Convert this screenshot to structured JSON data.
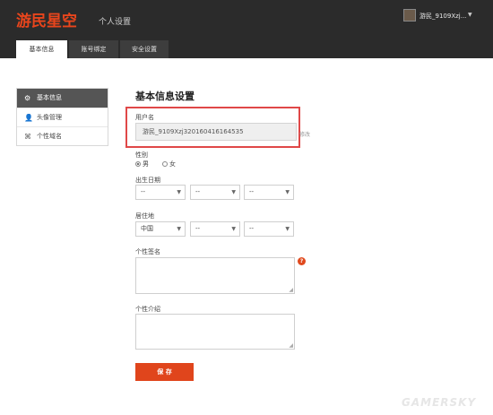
{
  "header": {
    "brand": "游民星空",
    "subtitle": "个人设置",
    "username": "游民_9109Xzj...",
    "caret": "▼",
    "tabs": [
      {
        "label": "基本信息"
      },
      {
        "label": "账号绑定"
      },
      {
        "label": "安全设置"
      }
    ]
  },
  "sidebar": {
    "items": [
      {
        "label": "基本信息",
        "icon": "gear-icon"
      },
      {
        "label": "头像管理",
        "icon": "user-icon"
      },
      {
        "label": "个性域名",
        "icon": "domain-icon"
      }
    ]
  },
  "form": {
    "title": "基本信息设置",
    "username_label": "用户名",
    "username_value": "游民_9109Xzj320160416164535",
    "modify_link": "修改",
    "gender_label": "性别",
    "gender_male": "男",
    "gender_female": "女",
    "birthday_label": "出生日期",
    "birthday": [
      "--",
      "--",
      "--"
    ],
    "residence_label": "居住地",
    "residence": [
      "中国",
      "--",
      "--"
    ],
    "signature_label": "个性签名",
    "intro_label": "个性介绍",
    "save_label": "保 存"
  },
  "watermark": "GAMERSKY",
  "colors": {
    "accent": "#e0451c",
    "header_bg": "#2b2b2b",
    "highlight": "#e04848"
  }
}
